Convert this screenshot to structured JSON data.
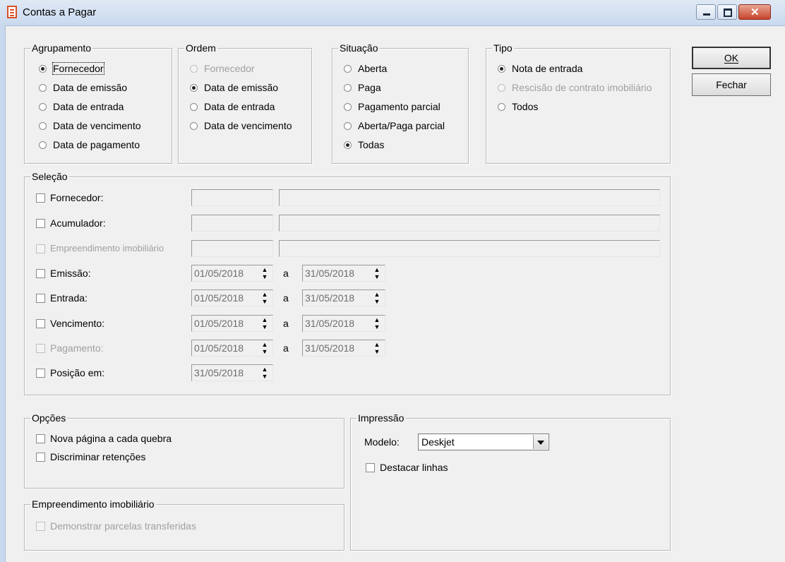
{
  "window": {
    "title": "Contas a Pagar"
  },
  "buttons": {
    "ok": "OK",
    "fechar": "Fechar"
  },
  "agrupamento": {
    "title": "Agrupamento",
    "options": [
      "Fornecedor",
      "Data de emissão",
      "Data de entrada",
      "Data de vencimento",
      "Data de pagamento"
    ],
    "selected": "Fornecedor"
  },
  "ordem": {
    "title": "Ordem",
    "options": [
      "Fornecedor",
      "Data de emissão",
      "Data de entrada",
      "Data de vencimento"
    ],
    "selected": "Data de emissão"
  },
  "situacao": {
    "title": "Situação",
    "options": [
      "Aberta",
      "Paga",
      "Pagamento parcial",
      "Aberta/Paga parcial",
      "Todas"
    ],
    "selected": "Todas"
  },
  "tipo": {
    "title": "Tipo",
    "options": [
      "Nota de entrada",
      "Rescisão de contrato imobiliário",
      "Todos"
    ],
    "selected": "Nota de entrada"
  },
  "selecao": {
    "title": "Seleção",
    "fornecedor": "Fornecedor:",
    "acumulador": "Acumulador:",
    "empreendimento": "Empreendimento imobiliário",
    "emissao": {
      "label": "Emissão:",
      "from": "01/05/2018",
      "to": "31/05/2018"
    },
    "entrada": {
      "label": "Entrada:",
      "from": "01/05/2018",
      "to": "31/05/2018"
    },
    "vencimento": {
      "label": "Vencimento:",
      "from": "01/05/2018",
      "to": "31/05/2018"
    },
    "pagamento": {
      "label": "Pagamento:",
      "from": "01/05/2018",
      "to": "31/05/2018"
    },
    "posicao": {
      "label": "Posição em:",
      "value": "31/05/2018"
    },
    "range_sep": "a"
  },
  "opcoes": {
    "title": "Opções",
    "nova_pagina": "Nova página a cada quebra",
    "discriminar": "Discriminar retenções"
  },
  "empreendimento_group": {
    "title": "Empreendimento imobiliário",
    "demonstrar": "Demonstrar parcelas transferidas"
  },
  "impressao": {
    "title": "Impressão",
    "modelo_label": "Modelo:",
    "modelo_value": "Deskjet",
    "destacar": "Destacar linhas"
  }
}
